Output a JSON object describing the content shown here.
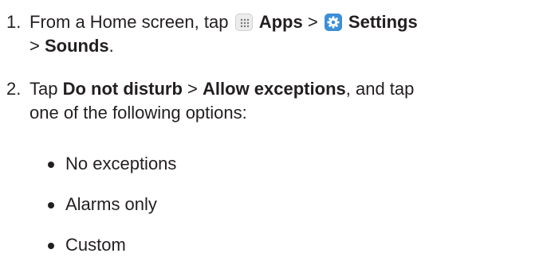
{
  "steps": [
    {
      "number": "1.",
      "parts": {
        "a": "From a Home screen, tap",
        "apps": "Apps",
        "sep1": ">",
        "settings": "Settings",
        "sep2": ">",
        "sounds": "Sounds",
        "end": "."
      },
      "icons": {
        "apps": "apps-grid-icon",
        "settings": "settings-gear-icon"
      }
    },
    {
      "number": "2.",
      "parts": {
        "a": "Tap",
        "dnd": "Do not disturb",
        "sep": ">",
        "allow": "Allow exceptions",
        "b": ", and tap",
        "c": "one of the following options:"
      }
    }
  ],
  "options": [
    "No exceptions",
    "Alarms only",
    "Custom"
  ],
  "colors": {
    "text": "#231f20",
    "settings_icon": "#3b8fd9",
    "apps_icon_bg": "#ececec"
  }
}
